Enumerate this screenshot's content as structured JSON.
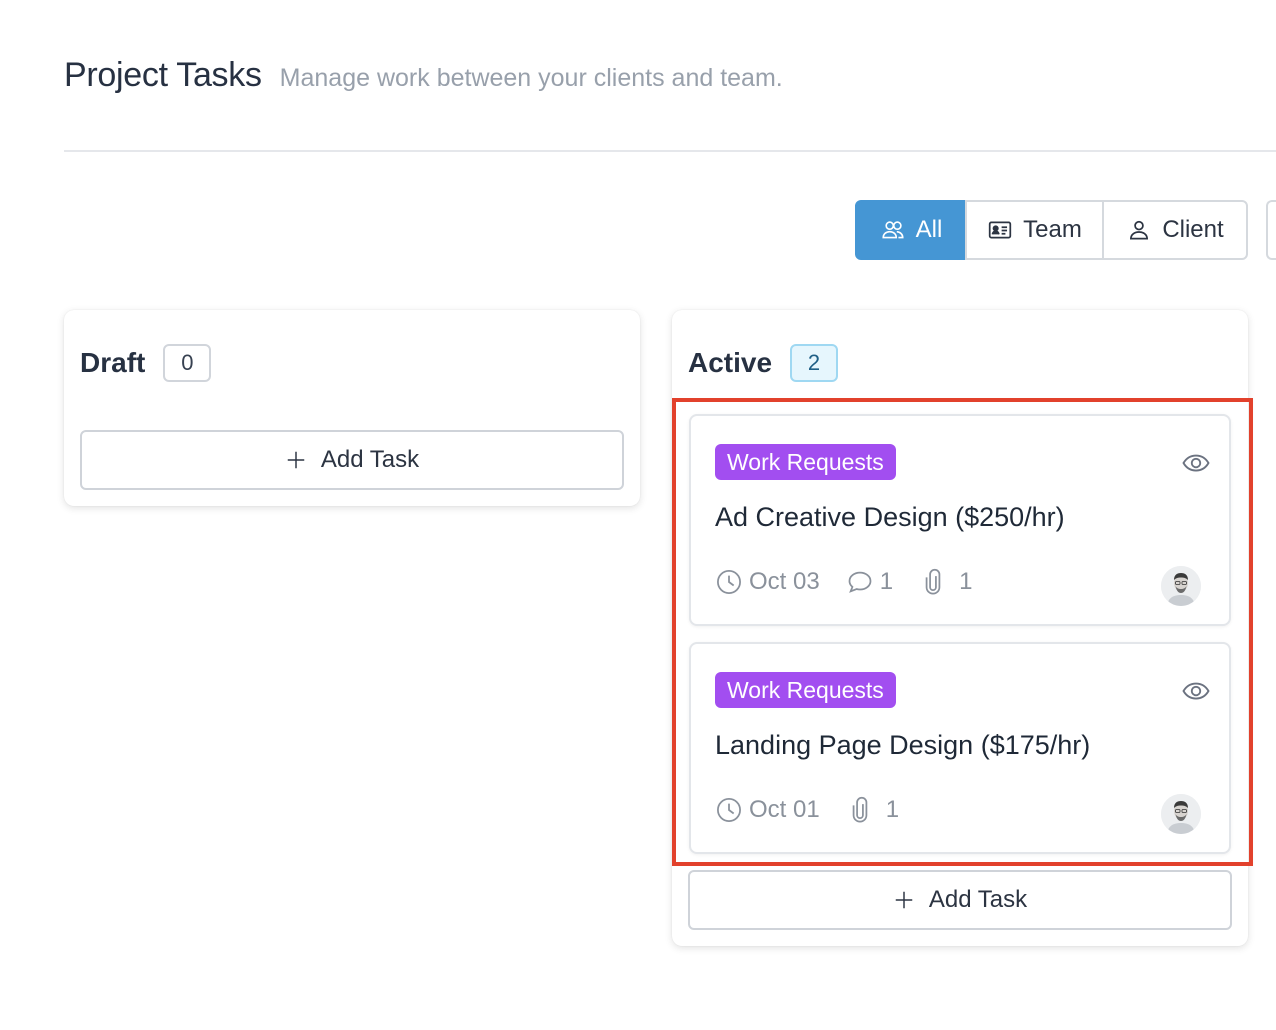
{
  "header": {
    "title": "Project Tasks",
    "subtitle": "Manage work between your clients and team."
  },
  "filters": [
    {
      "label": "All",
      "icon": "users-icon",
      "active": true
    },
    {
      "label": "Team",
      "icon": "id-card-icon",
      "active": false
    },
    {
      "label": "Client",
      "icon": "user-icon",
      "active": false
    }
  ],
  "columns": {
    "draft": {
      "title": "Draft",
      "count": "0",
      "add_label": "Add Task"
    },
    "active": {
      "title": "Active",
      "count": "2",
      "add_label": "Add Task"
    }
  },
  "cards": [
    {
      "tag": "Work Requests",
      "title": "Ad Creative Design ($250/hr)",
      "date": "Oct 03",
      "comments": "1",
      "attachments": "1"
    },
    {
      "tag": "Work Requests",
      "title": "Landing Page Design ($175/hr)",
      "date": "Oct 01",
      "attachments": "1"
    }
  ],
  "colors": {
    "accent": "#4596d4",
    "tag": "#a24ef0",
    "highlight": "#e2412c"
  }
}
